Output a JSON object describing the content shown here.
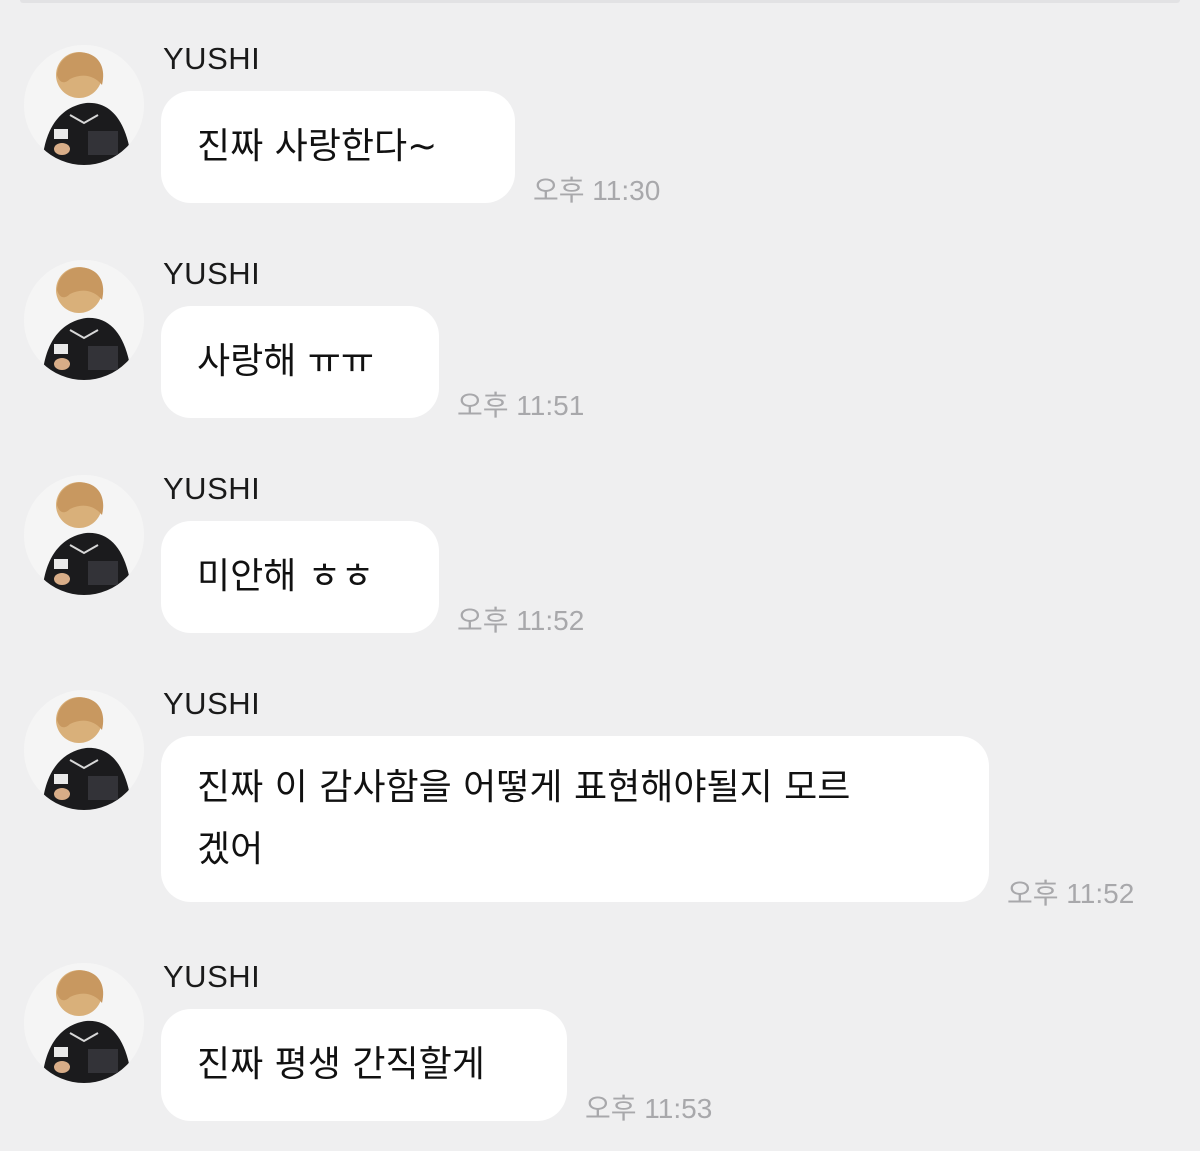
{
  "chat": {
    "messages": [
      {
        "sender": "YUSHI",
        "text": "진짜 사랑한다~",
        "time": "오후 11:30"
      },
      {
        "sender": "YUSHI",
        "text": "사랑해 ㅠㅠ",
        "time": "오후 11:51"
      },
      {
        "sender": "YUSHI",
        "text": "미안해 ㅎㅎ",
        "time": "오후 11:52"
      },
      {
        "sender": "YUSHI",
        "text": "진짜 이 감사함을 어떻게 표현해야될지 모르겠어",
        "text_line1": "진짜 이 감사함을 어떻게 표현해야될지 모르",
        "text_line2": "겠어",
        "time": "오후 11:52"
      },
      {
        "sender": "YUSHI",
        "text": "진짜 평생 간직할게",
        "time": "오후 11:53"
      }
    ]
  },
  "colors": {
    "background": "#efeff0",
    "bubble": "#ffffff",
    "timestamp": "#a8a8ab",
    "text": "#111111"
  },
  "icons": {
    "avatar": "profile-photo"
  }
}
